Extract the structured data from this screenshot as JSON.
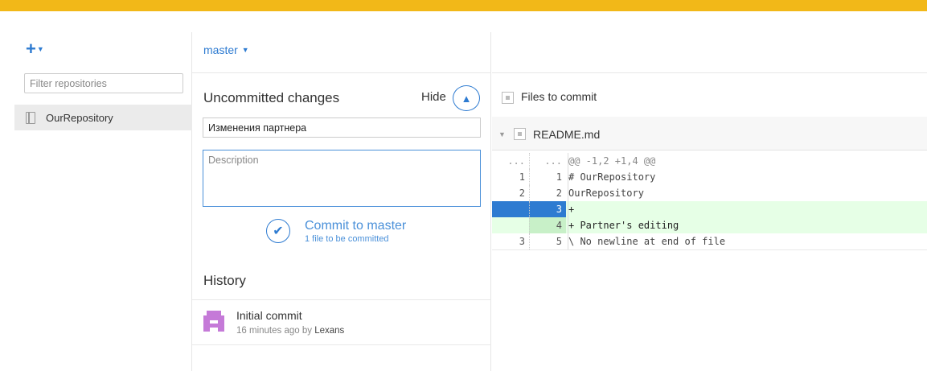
{
  "colors": {
    "accent_bar": "#f2b818",
    "link_blue": "#2e7bd1",
    "add_bg": "#e6ffe6",
    "selected_line": "#2e7bd1"
  },
  "sidebar": {
    "add_icon": "plus-icon",
    "filter_placeholder": "Filter repositories",
    "repositories": [
      {
        "label": "OurRepository",
        "icon": "repo-book-icon"
      }
    ]
  },
  "branch": {
    "name": "master"
  },
  "changes": {
    "title": "Uncommitted changes",
    "hide_label": "Hide",
    "summary_value": "Изменения партнера",
    "description_placeholder": "Description",
    "commit_button": "Commit to master",
    "commit_subtitle": "1 file to be committed"
  },
  "history": {
    "title": "History",
    "commits": [
      {
        "message": "Initial commit",
        "time": "16 minutes ago by",
        "author": "Lexans"
      }
    ]
  },
  "diff": {
    "files_to_commit_label": "Files to commit",
    "file_name": "README.md",
    "lines": [
      {
        "old": "...",
        "new": "...",
        "text": "@@ -1,2 +1,4 @@",
        "type": "hunk"
      },
      {
        "old": "1",
        "new": "1",
        "text": "# OurRepository",
        "type": "context"
      },
      {
        "old": "2",
        "new": "2",
        "text": "OurRepository",
        "type": "context"
      },
      {
        "old": "",
        "new": "3",
        "text": "+",
        "type": "add-selected"
      },
      {
        "old": "",
        "new": "4",
        "text": "+ Partner's editing",
        "type": "add"
      },
      {
        "old": "3",
        "new": "5",
        "text": "\\ No newline at end of file",
        "type": "context"
      }
    ]
  }
}
